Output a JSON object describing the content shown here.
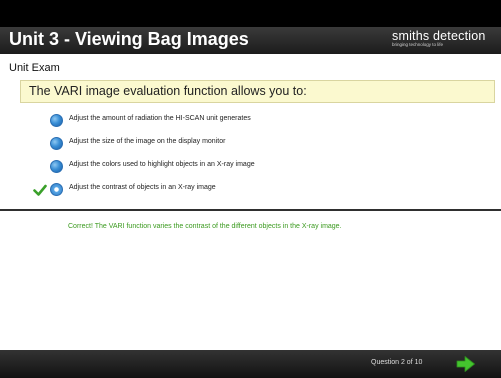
{
  "header": {
    "title": "Unit 3 - Viewing Bag Images",
    "brand_name": "smiths detection",
    "brand_tagline": "bringing technology to life"
  },
  "section": {
    "title": "Unit Exam"
  },
  "question": {
    "text": "The VARI image evaluation function allows you to:",
    "options": [
      {
        "label": "Adjust the amount of radiation the HI-SCAN unit generates",
        "selected": false,
        "correct": false
      },
      {
        "label": "Adjust the size of the image on the display monitor",
        "selected": false,
        "correct": false
      },
      {
        "label": "Adjust the colors used to highlight objects in an X-ray image",
        "selected": false,
        "correct": false
      },
      {
        "label": "Adjust the contrast of objects in an X-ray image",
        "selected": true,
        "correct": true
      }
    ],
    "feedback": "Correct! The VARI function varies the contrast of the different objects in the X-ray image."
  },
  "footer": {
    "progress": "Question 2 of 10",
    "next_icon": "green-arrow-right"
  },
  "colors": {
    "header_bg": "#1c1c1c",
    "question_bg": "#fbf9cf",
    "feedback_text": "#3a9a1e",
    "radio_blue": "#3a8fd6",
    "check_green": "#3aa02a",
    "next_arrow": "#44c42e"
  }
}
